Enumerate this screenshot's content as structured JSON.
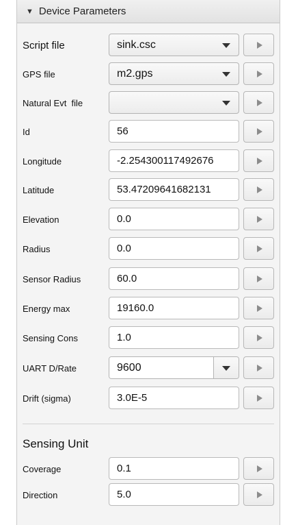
{
  "section": {
    "title": "Device Parameters"
  },
  "params": {
    "script_file": {
      "label": "Script file",
      "value": "sink.csc"
    },
    "gps_file": {
      "label": "GPS file",
      "value": "m2.gps"
    },
    "natural_evt_file": {
      "label": "Natural Evt  file",
      "value": ""
    },
    "id": {
      "label": "Id",
      "value": "56"
    },
    "longitude": {
      "label": "Longitude",
      "value": "-2.254300117492676"
    },
    "latitude": {
      "label": "Latitude",
      "value": "53.47209641682131"
    },
    "elevation": {
      "label": "Elevation",
      "value": "0.0"
    },
    "radius": {
      "label": "Radius",
      "value": "0.0"
    },
    "sensor_radius": {
      "label": "Sensor Radius",
      "value": "60.0"
    },
    "energy_max": {
      "label": "Energy max",
      "value": "19160.0"
    },
    "sensing_cons": {
      "label": "Sensing Cons",
      "value": "1.0"
    },
    "uart_rate": {
      "label": "UART D/Rate",
      "value": "9600"
    },
    "drift": {
      "label": "Drift (sigma)",
      "value": "3.0E-5"
    }
  },
  "sensing_unit": {
    "title": "Sensing Unit",
    "coverage": {
      "label": "Coverage",
      "value": "0.1"
    },
    "direction": {
      "label": "Direction",
      "value": "5.0"
    }
  },
  "icons": {
    "collapse": "triangle-down-icon",
    "apply": "play-icon",
    "dropdown": "chevron-down-icon"
  }
}
